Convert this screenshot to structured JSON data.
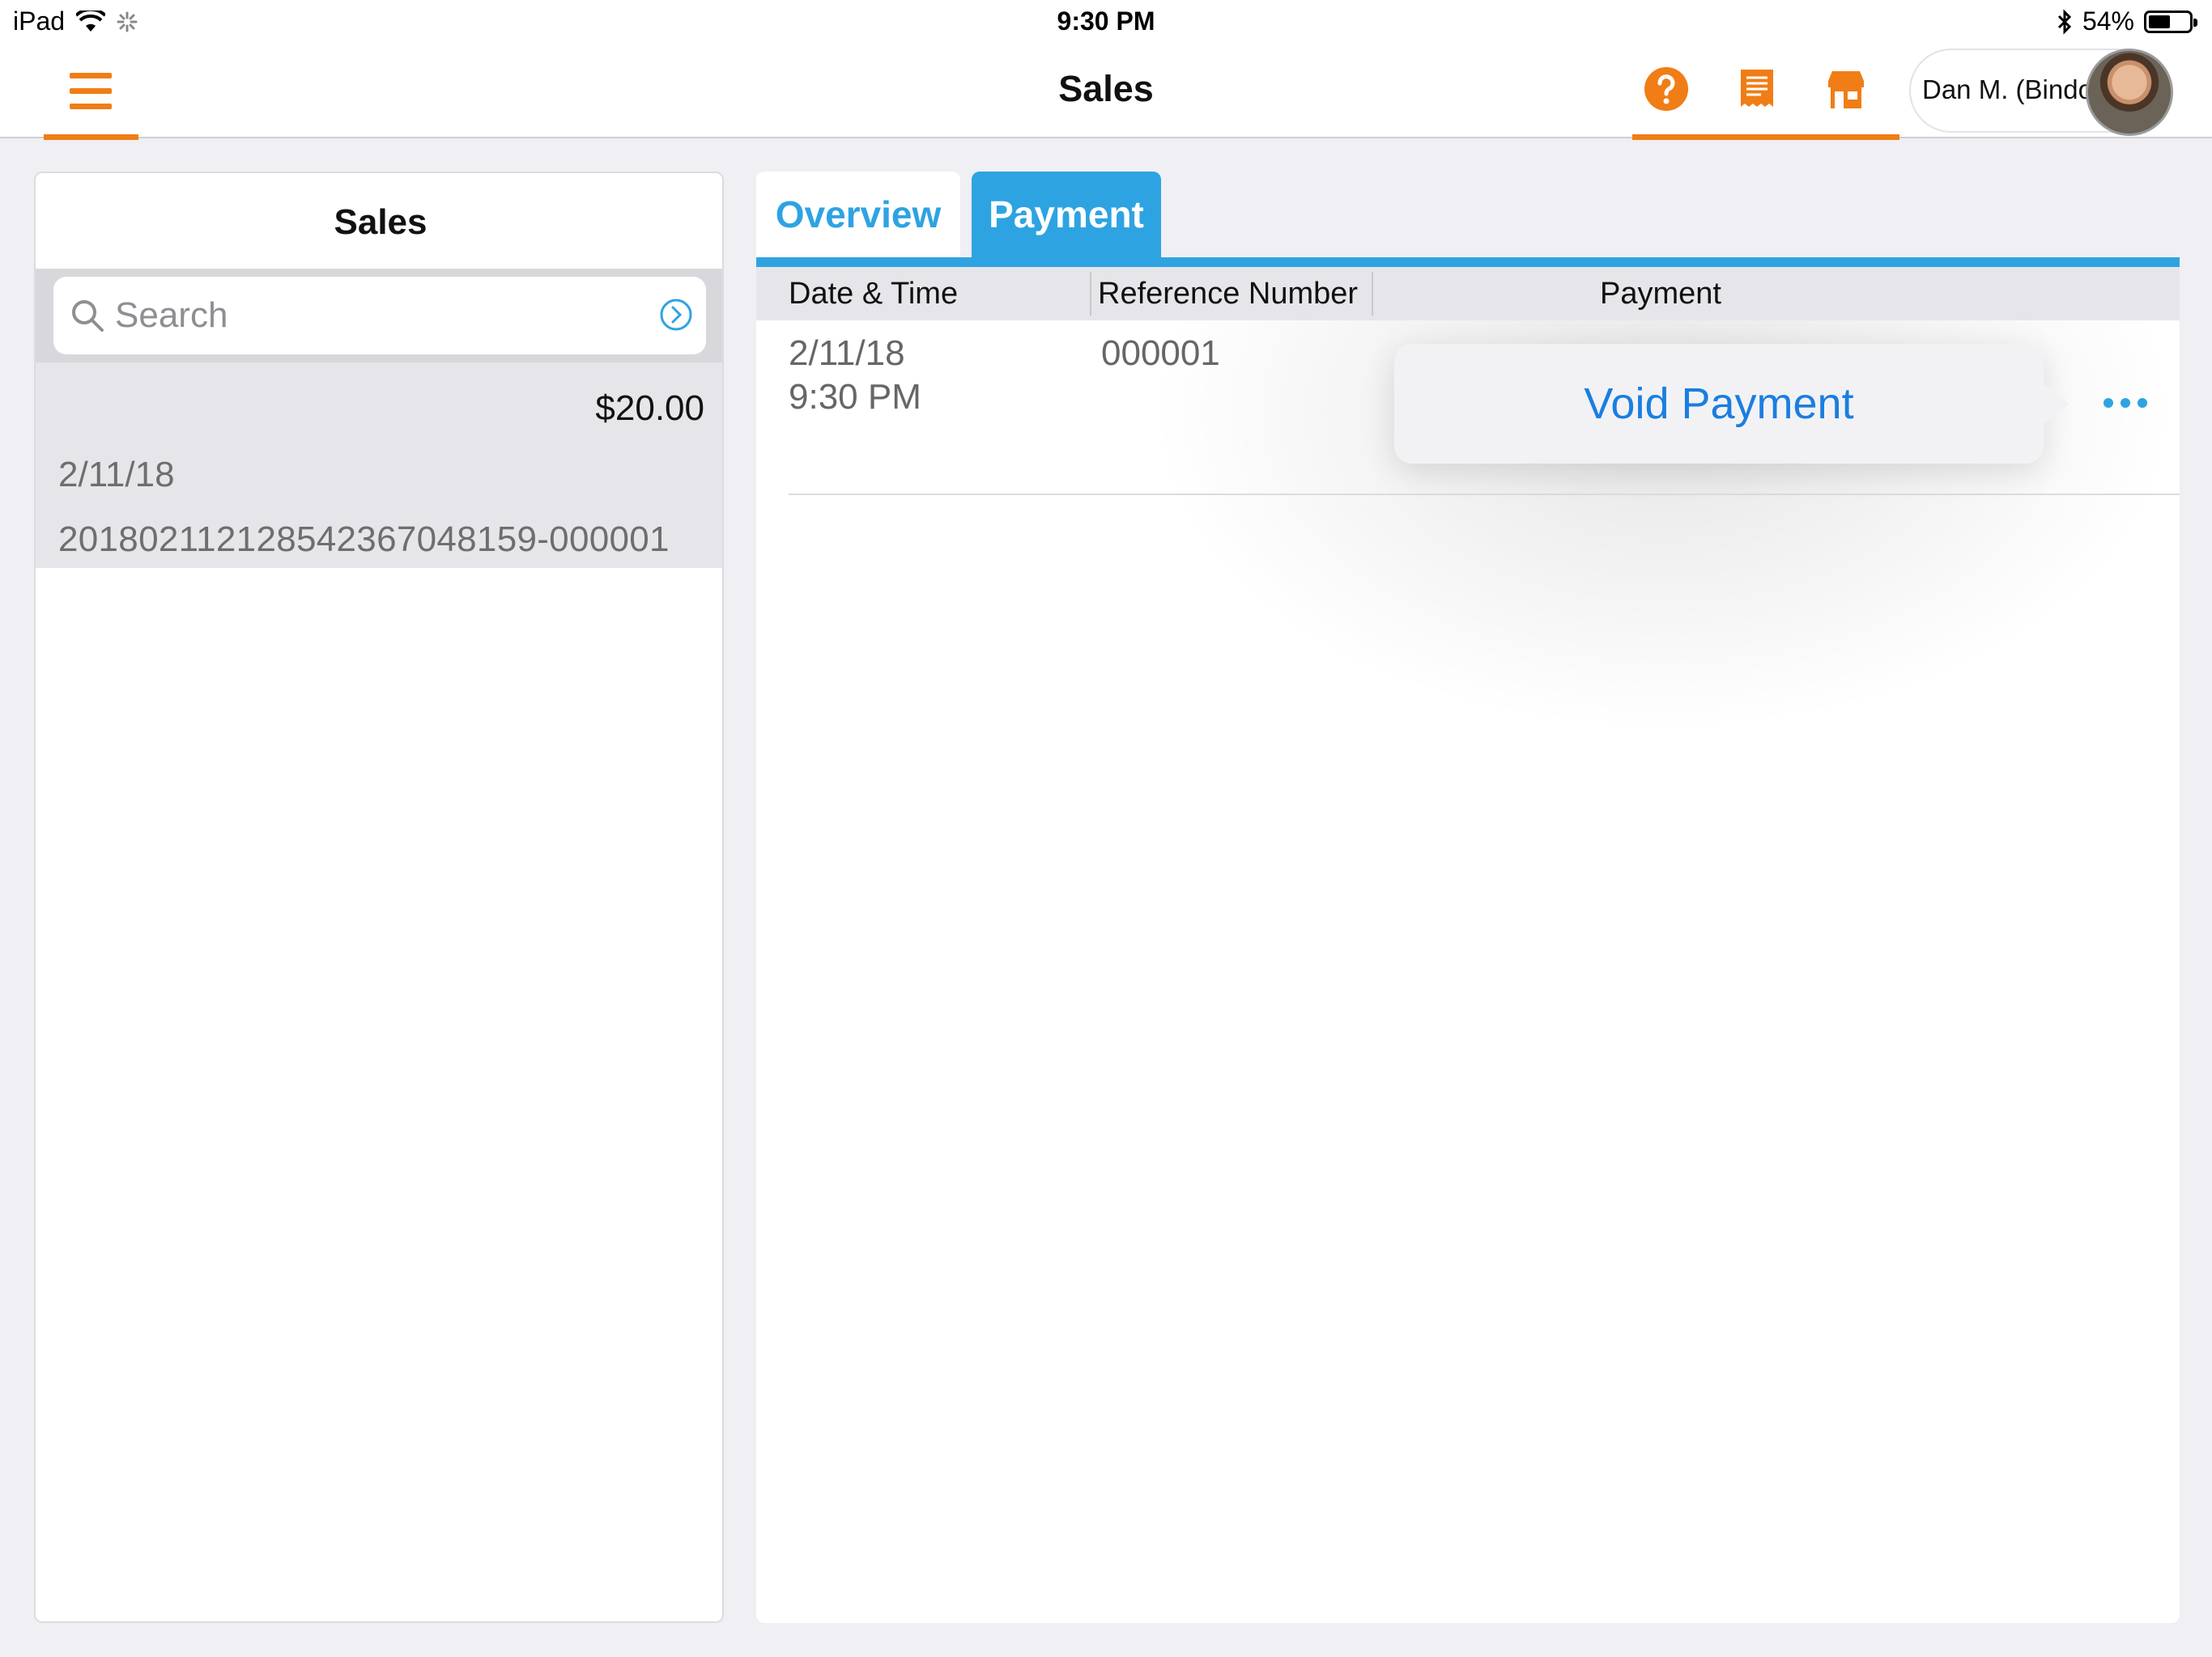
{
  "status_bar": {
    "device": "iPad",
    "time": "9:30 PM",
    "battery_percent": "54%",
    "battery_level": 0.54
  },
  "nav": {
    "title": "Sales",
    "user_name": "Dan M. (Bindo)",
    "accent_color": "#f07d16",
    "icons": [
      "menu-icon",
      "help-icon",
      "receipt-icon",
      "store-icon"
    ]
  },
  "sales_list": {
    "title": "Sales",
    "search_placeholder": "Search",
    "items": [
      {
        "amount": "$20.00",
        "date": "2/11/18",
        "id": "20180211212854236704815​9-000001"
      }
    ]
  },
  "detail": {
    "tabs": [
      {
        "label": "Overview",
        "selected": false
      },
      {
        "label": "Payment",
        "selected": true
      }
    ],
    "tab_color": "#2ea3e2",
    "columns": [
      "Date & Time",
      "Reference Number",
      "Payment"
    ],
    "rows": [
      {
        "date": "2/11/18",
        "time": "9:30 PM",
        "reference": "000001",
        "payment_fragment": ")"
      }
    ],
    "popover": {
      "action": "Void Payment"
    }
  }
}
